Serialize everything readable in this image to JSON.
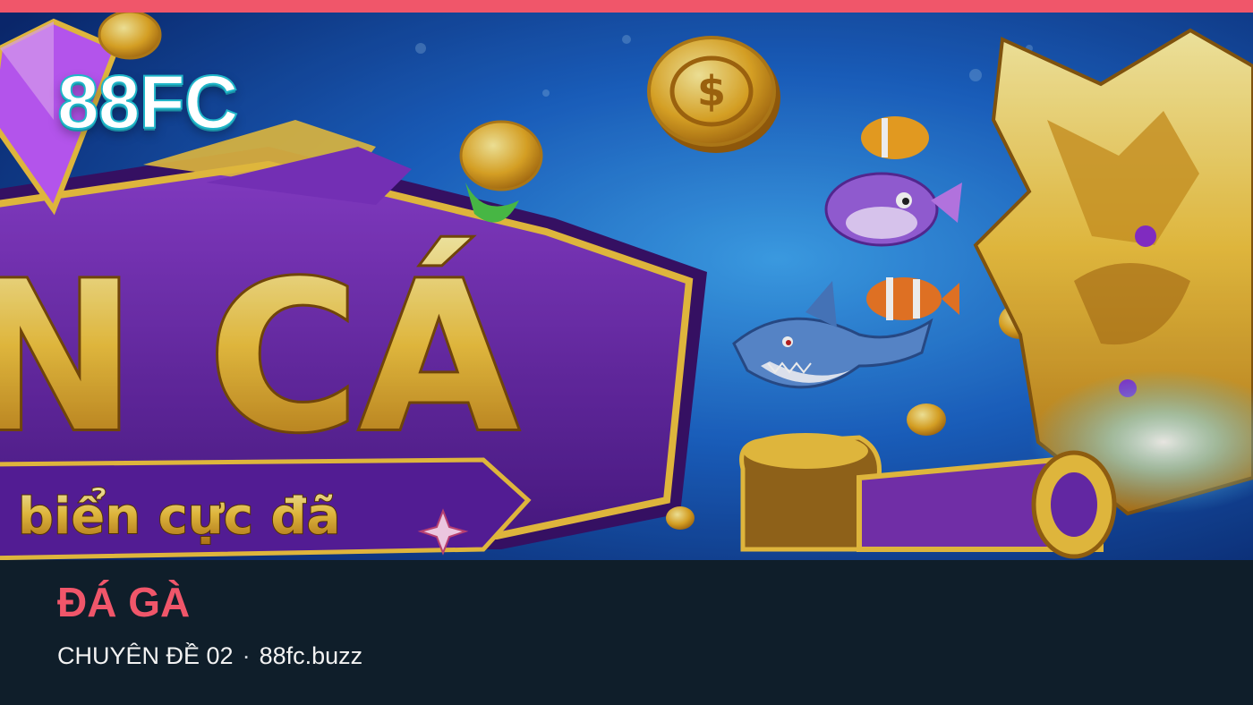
{
  "brand": {
    "logo_text": "88FC"
  },
  "hero": {
    "banner_title": "N CÁ",
    "banner_subtitle": "biển cực đã",
    "icons": [
      "coin-icon",
      "diamond-icon",
      "shark-icon",
      "clownfish-icon",
      "pufferfish-icon",
      "treasure-cannon-icon",
      "sparkle-icon"
    ]
  },
  "footer": {
    "title": "ĐÁ GÀ",
    "topic": "CHUYÊN ĐỀ 02",
    "separator": "·",
    "domain": "88fc.buzz"
  },
  "colors": {
    "accent": "#f0566a",
    "footer_bg": "#0f1e2a",
    "ocean": "#1c64c8",
    "purple": "#6b2bb0",
    "gold": "#e9b634"
  }
}
